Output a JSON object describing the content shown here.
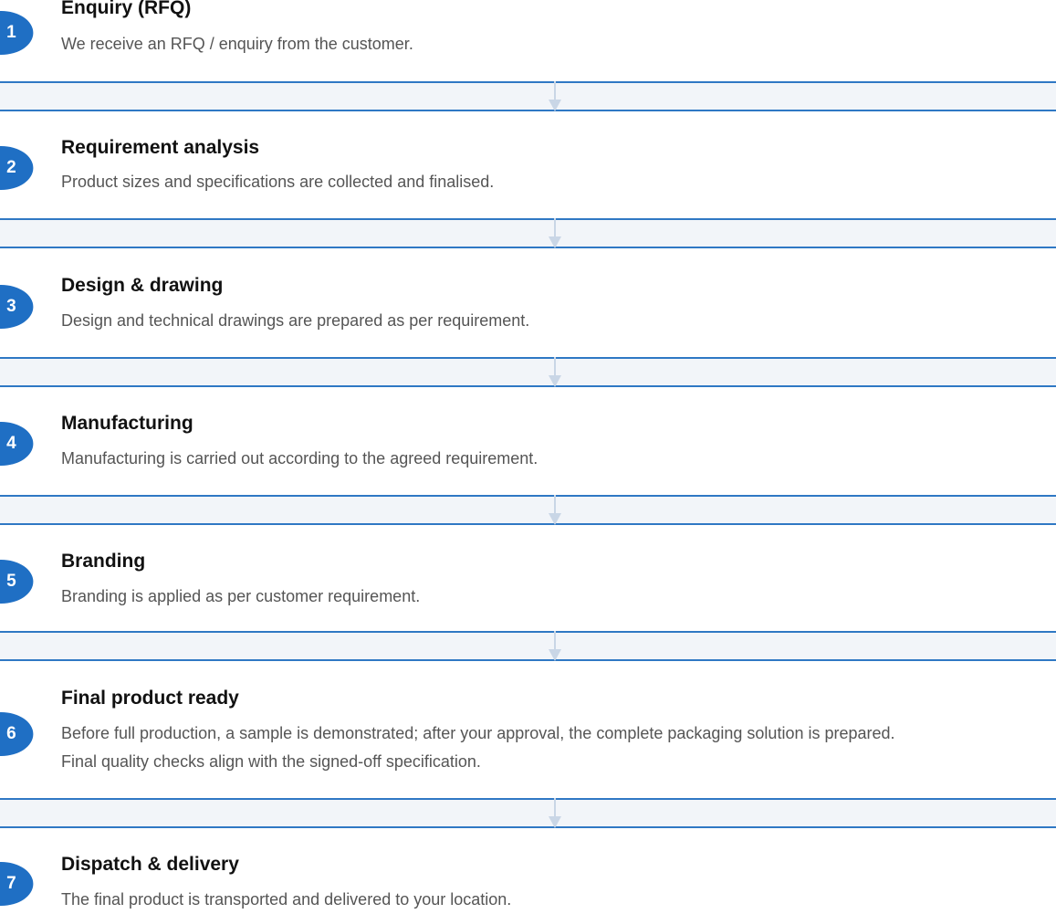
{
  "steps": [
    {
      "number": "1",
      "title": "Enquiry (RFQ)",
      "lines": [
        "We receive an RFQ / enquiry from the customer."
      ]
    },
    {
      "number": "2",
      "title": "Requirement analysis",
      "lines": [
        "Product sizes and specifications are collected and finalised."
      ]
    },
    {
      "number": "3",
      "title": "Design & drawing",
      "lines": [
        "Design and technical drawings are prepared as per requirement."
      ]
    },
    {
      "number": "4",
      "title": "Manufacturing",
      "lines": [
        "Manufacturing is carried out according to the agreed requirement."
      ]
    },
    {
      "number": "5",
      "title": "Branding",
      "lines": [
        "Branding is applied as per customer requirement."
      ]
    },
    {
      "number": "6",
      "title": "Final product ready",
      "lines": [
        "Before full production, a sample is demonstrated; after your approval, the complete packaging solution is prepared.",
        "Final quality checks align with the signed-off specification."
      ]
    },
    {
      "number": "7",
      "title": "Dispatch & delivery",
      "lines": [
        "The final product is transported and delivered to your location."
      ]
    }
  ],
  "colors": {
    "badge": "#1f6fc4",
    "connector_border": "#2f78c4",
    "connector_fill": "#f2f5f9",
    "arrow": "#c9d6e6"
  }
}
